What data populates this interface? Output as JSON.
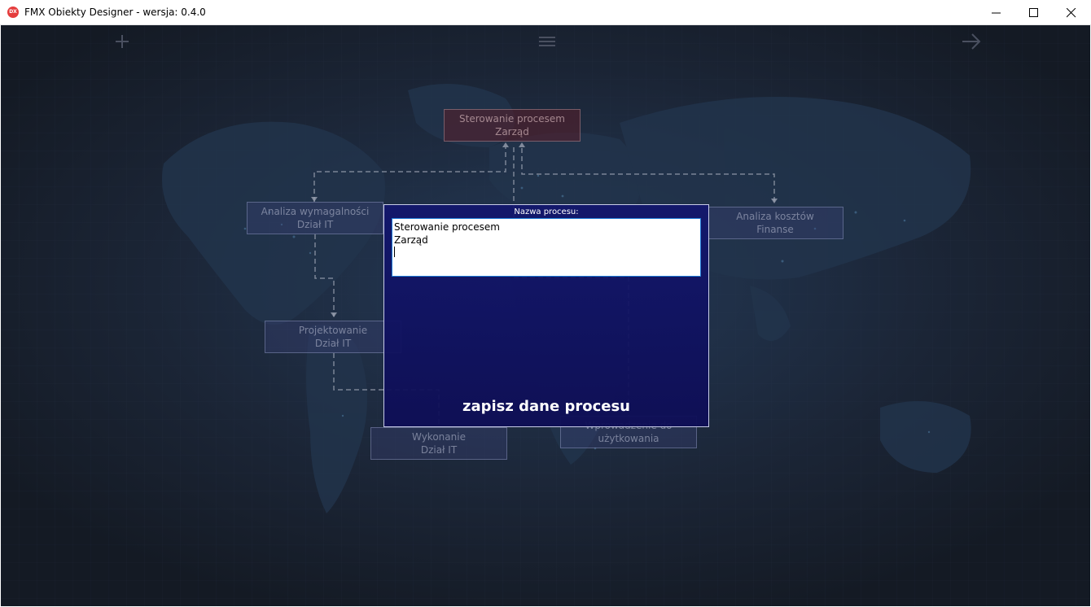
{
  "window": {
    "title": "FMX Obiekty Designer - wersja: 0.4.0",
    "icon_text": "DX",
    "icon_color": "#e53d3d"
  },
  "toolbar": {
    "add_icon": "plus-icon",
    "menu_icon": "hamburger-icon",
    "next_icon": "arrow-right-icon"
  },
  "nodes": {
    "root": {
      "line1": "Sterowanie procesem",
      "line2": "Zarząd"
    },
    "analiza_wymagalnosci": {
      "line1": "Analiza wymagalności",
      "line2": "Dział IT"
    },
    "analiza_kosztow": {
      "line1": "Analiza kosztów",
      "line2": "Finanse"
    },
    "projektowanie": {
      "line1": "Projektowanie",
      "line2": "Dział IT"
    },
    "wykonanie": {
      "line1": "Wykonanie",
      "line2": "Dział IT"
    },
    "wprowadzenie": {
      "line1": "Wprowadzenie do",
      "line2": "użytkowania"
    }
  },
  "dialog": {
    "label": "Nazwa procesu:",
    "value_line1": "Sterowanie procesem",
    "value_line2": "Zarząd",
    "save_label": "zapisz dane procesu"
  },
  "colors": {
    "background": "#161c28",
    "dialog_bg": "#12166e",
    "root_node": "#5a1e28",
    "node": "#3c4278",
    "connector": "#9aa0b0"
  }
}
